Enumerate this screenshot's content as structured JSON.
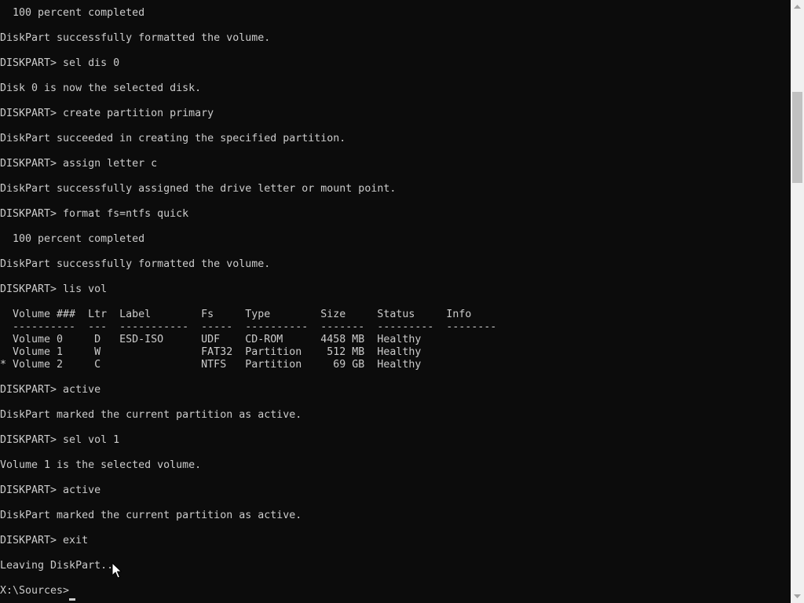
{
  "console": {
    "lines": [
      "  100 percent completed",
      "",
      "DiskPart successfully formatted the volume.",
      "",
      "DISKPART> sel dis 0",
      "",
      "Disk 0 is now the selected disk.",
      "",
      "DISKPART> create partition primary",
      "",
      "DiskPart succeeded in creating the specified partition.",
      "",
      "DISKPART> assign letter c",
      "",
      "DiskPart successfully assigned the drive letter or mount point.",
      "",
      "DISKPART> format fs=ntfs quick",
      "",
      "  100 percent completed",
      "",
      "DiskPart successfully formatted the volume.",
      "",
      "DISKPART> lis vol",
      "",
      "  Volume ###  Ltr  Label        Fs     Type        Size     Status     Info",
      "  ----------  ---  -----------  -----  ----------  -------  ---------  --------",
      "  Volume 0     D   ESD-ISO      UDF    CD-ROM      4458 MB  Healthy",
      "  Volume 1     W                FAT32  Partition    512 MB  Healthy",
      "* Volume 2     C                NTFS   Partition     69 GB  Healthy",
      "",
      "DISKPART> active",
      "",
      "DiskPart marked the current partition as active.",
      "",
      "DISKPART> sel vol 1",
      "",
      "Volume 1 is the selected volume.",
      "",
      "DISKPART> active",
      "",
      "DiskPart marked the current partition as active.",
      "",
      "DISKPART> exit",
      "",
      "Leaving DiskPart...",
      "",
      "X:\\Sources>"
    ]
  },
  "scrollbar": {
    "up_icon": "arrow-up-icon",
    "down_icon": "arrow-down-icon"
  },
  "colors": {
    "background": "#0c0c0c",
    "text": "#cccccc",
    "scrollbar_track": "#f0f0f0",
    "scrollbar_thumb": "#c1c1c1"
  }
}
